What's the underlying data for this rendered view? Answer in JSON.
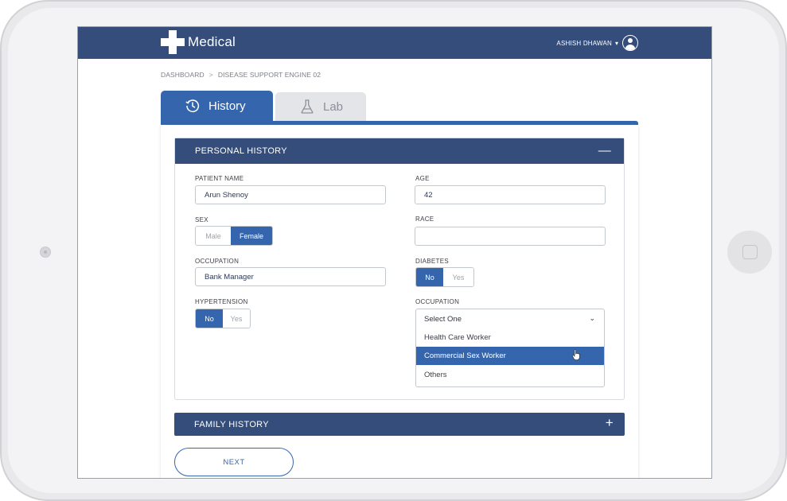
{
  "app": {
    "brand": "Medical",
    "user_name": "ASHISH DHAWAN",
    "caret": "▾"
  },
  "breadcrumb": {
    "items": [
      "DASHBOARD",
      "DISEASE SUPPORT ENGINE 02"
    ],
    "separator": ">"
  },
  "tabs": [
    {
      "label": "History",
      "active": true,
      "icon": "clock-history-icon"
    },
    {
      "label": "Lab",
      "active": false,
      "icon": "flask-icon"
    }
  ],
  "personal_history": {
    "title": "PERSONAL HISTORY",
    "collapse_symbol": "—",
    "patient_name": {
      "label": "PATIENT NAME",
      "value": "Arun Shenoy"
    },
    "age": {
      "label": "AGE",
      "value": "42"
    },
    "sex": {
      "label": "SEX",
      "options": [
        "Male",
        "Female"
      ],
      "selected": "Female"
    },
    "race": {
      "label": "RACE",
      "value": ""
    },
    "occupation": {
      "label": "OCCUPATION",
      "value": "Bank Manager"
    },
    "diabetes": {
      "label": "DIABETES",
      "options": [
        "No",
        "Yes"
      ],
      "selected": "No"
    },
    "hypertension": {
      "label": "HYPERTENSION",
      "options": [
        "No",
        "Yes"
      ],
      "selected": "No"
    },
    "occupation_select": {
      "label": "OCCUPATION",
      "selected_text": "Select One",
      "chevron": "⌄",
      "options": [
        "Health Care Worker",
        "Commercial Sex Worker",
        "Others"
      ],
      "highlighted": "Commercial Sex Worker"
    }
  },
  "family_history": {
    "title": "FAMILY HISTORY",
    "expand_symbol": "+"
  },
  "actions": {
    "next_label": "NEXT"
  },
  "colors": {
    "primary": "#3566ad",
    "header": "#354d7a",
    "inactive_tab": "#e4e5e8"
  }
}
